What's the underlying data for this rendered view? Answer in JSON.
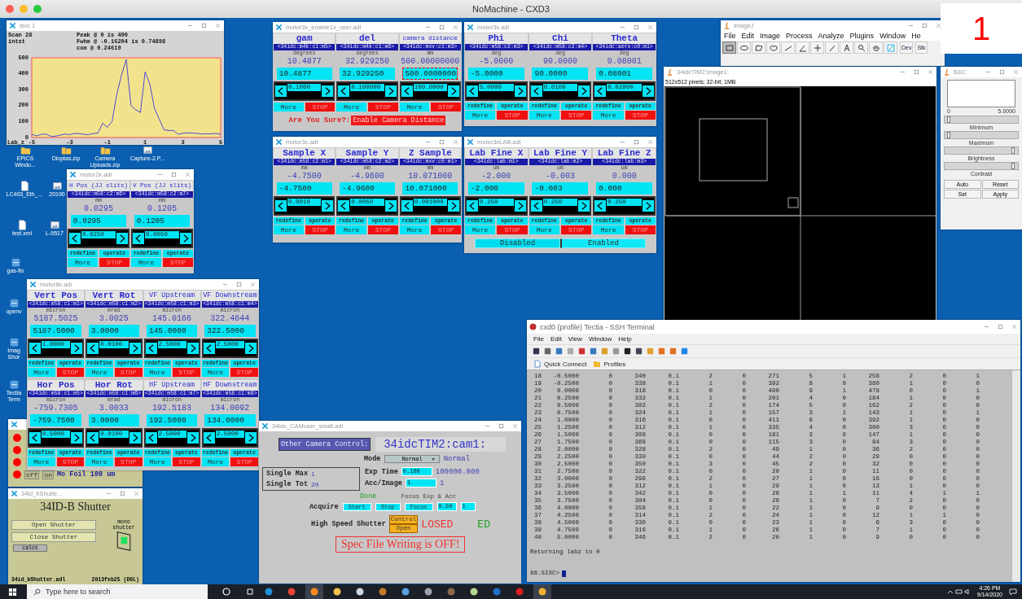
{
  "host_window": {
    "title": "NoMachine - CXD3"
  },
  "corner_label": "1",
  "desktop_icons": [
    {
      "label": "EPICS Windo...",
      "kind": "folder"
    },
    {
      "label": "Dioptas.zip",
      "kind": "zip"
    },
    {
      "label": "Camera Uploads.zip",
      "kind": "zip"
    },
    {
      "label": "Capture-2.P...",
      "kind": "image"
    },
    {
      "label": "LC403_Eth_...",
      "kind": "file"
    },
    {
      "label": "20190",
      "kind": "image"
    },
    {
      "label": "test.xml",
      "kind": "file"
    },
    {
      "label": "L-9517",
      "kind": "image"
    },
    {
      "label": "gas-flo",
      "kind": "app"
    },
    {
      "label": "openv",
      "kind": "app"
    },
    {
      "label": "Imag Shor",
      "kind": "app"
    },
    {
      "label": "Tectia Term",
      "kind": "app"
    }
  ],
  "plot_window": {
    "title": "sixc 1",
    "scan_label": "Scan 28",
    "stats": [
      "Peak @ 0 is 490",
      "Fwhm @ -0.16204 is 0.74898",
      "com @ 0.24619"
    ],
    "chart_data": {
      "type": "line",
      "xlabel": "Lab_z",
      "x": [
        -5,
        -4.75,
        -4.5,
        -4.25,
        -4,
        -3.75,
        -3.5,
        -3.25,
        -3,
        -2.75,
        -2.5,
        -2.25,
        -2,
        -1.75,
        -1.5,
        -1.25,
        -1,
        -0.75,
        -0.5,
        -0.25,
        0,
        0.25,
        0.5,
        0.75,
        1,
        1.25,
        1.5,
        1.75,
        2,
        2.25,
        2.5,
        2.75,
        3,
        3.25,
        3.5,
        3.75,
        4,
        4.25,
        4.5,
        4.75,
        5
      ],
      "series": [
        {
          "name": "intst",
          "color": "#4a4ad8",
          "values": [
            20,
            10,
            20,
            22,
            8,
            8,
            15,
            22,
            18,
            25,
            25,
            20,
            18,
            25,
            28,
            90,
            65,
            100,
            271,
            392,
            490,
            201,
            174,
            157,
            411,
            335,
            181,
            115,
            49,
            44,
            45,
            20,
            27,
            29,
            28,
            26,
            22,
            24,
            23,
            26,
            20
          ]
        }
      ],
      "xlim": [
        -5,
        5
      ],
      "ylim": [
        0,
        500
      ],
      "xticks": [
        -5,
        -3,
        -1,
        1,
        3,
        5
      ],
      "yticks": [
        0,
        100,
        200,
        300,
        400,
        500
      ]
    }
  },
  "motor_windows": [
    {
      "title": "motor3x_enable1x_user.adl",
      "motors": [
        {
          "name": "gam",
          "pv": "<34idc:m4k:c1:m5>",
          "unit": "degrees",
          "readback": "10.4877",
          "setpoint": "10.4877",
          "tweak": "0.1000",
          "focused": false,
          "more": "More",
          "stop": "STOP"
        },
        {
          "name": "del",
          "pv": "<34idc:m4k:c1:m6>",
          "unit": "degrees",
          "readback": "32.929250",
          "setpoint": "32.929250",
          "tweak": "0.100000",
          "focused": false,
          "more": "More",
          "stop": "STOP"
        },
        {
          "name": "camera distance",
          "pv": "<34idc:mxv:c1:m3>",
          "unit": "mm",
          "readback": "500.00000000",
          "setpoint": "500.0000000",
          "tweak": "100.0000",
          "focused": true,
          "more": "More",
          "stop": "STOP"
        }
      ],
      "confirm": {
        "label": "Are You Sure?:",
        "button": "Enable Camera Distance"
      }
    },
    {
      "title": "motor3x.adl",
      "motors": [
        {
          "name": "Phi",
          "pv": "<34idc:m58:c2:m3>",
          "unit": "deg",
          "readback": "-5.0000",
          "setpoint": "-5.0000",
          "tweak": "5.0000",
          "focused": false,
          "redefine": "redefine",
          "operate": "operate",
          "more": "More",
          "stop": "STOP"
        },
        {
          "name": "Chi",
          "pv": "<34idc:m58:c2:m4>",
          "unit": "deg",
          "readback": "90.0000",
          "setpoint": "90.0000",
          "tweak": "0.0100",
          "focused": false,
          "redefine": "redefine",
          "operate": "operate",
          "more": "More",
          "stop": "STOP"
        },
        {
          "name": "Theta",
          "pv": "<34idc:aero:c0:m1>",
          "unit": "deg",
          "readback": "0.08001",
          "setpoint": "0.08001",
          "tweak": "0.02000",
          "focused": false,
          "redefine": "redefine",
          "operate": "operate",
          "more": "More",
          "stop": "STOP"
        }
      ]
    },
    {
      "title": "motor2x.adl",
      "motors": [
        {
          "name": "H Pos (JJ slits)",
          "pv": "<34idc:m58:c2:m6>",
          "unit": "mm",
          "readback": "0.0295",
          "setpoint": "0.0295",
          "tweak": "0.0250",
          "focused": false,
          "redefine": "redefine",
          "operate": "operate",
          "more": "More",
          "stop": "STOP"
        },
        {
          "name": "V Pos (JJ slits)",
          "pv": "<34idc:m58:c2:m7>",
          "unit": "mm",
          "readback": "0.1205",
          "setpoint": "0.1205",
          "tweak": "0.0050",
          "focused": false,
          "redefine": "redefine",
          "operate": "operate",
          "more": "More",
          "stop": "STOP"
        }
      ]
    },
    {
      "title": "motor3x.adl",
      "motors": [
        {
          "name": "Sample X",
          "pv": "<34idc:m58:c2:m1>",
          "unit": "mm",
          "readback": "-4.7500",
          "setpoint": "-4.7500",
          "tweak": "0.0010",
          "focused": false,
          "redefine": "redefine",
          "operate": "operate",
          "more": "More",
          "stop": "STOP"
        },
        {
          "name": "Sample Y",
          "pv": "<34idc:m58:c2:m2>",
          "unit": "mm",
          "readback": "-4.9600",
          "setpoint": "-4.9600",
          "tweak": "0.0050",
          "focused": false,
          "redefine": "redefine",
          "operate": "operate",
          "more": "More",
          "stop": "STOP"
        },
        {
          "name": "Z Sample",
          "pv": "<34idc:mxv:c0:m1>",
          "unit": "mm",
          "readback": "10.071000",
          "setpoint": "10.071000",
          "tweak": "0.001000",
          "focused": false,
          "redefine": "redefine",
          "operate": "operate",
          "more": "More",
          "stop": "STOP"
        }
      ]
    },
    {
      "title": "motor3xLAB.adl",
      "motors": [
        {
          "name": "Lab Fine X",
          "pv": "<34idc:lab:m1>",
          "unit": "um",
          "readback": "-2.000",
          "setpoint": "-2.000",
          "tweak": "0.250",
          "focused": false,
          "redefine": "redefine",
          "operate": "operate",
          "more": "More",
          "stop": "STOP"
        },
        {
          "name": "Lab Fine Y",
          "pv": "<34idc:lab:m2>",
          "unit": "um",
          "readback": "-0.003",
          "setpoint": "-0.003",
          "tweak": "0.250",
          "focused": false,
          "redefine": "redefine",
          "operate": "operate",
          "more": "More",
          "stop": "STOP"
        },
        {
          "name": "Lab Fine Z",
          "pv": "<34idc:lab:m3>",
          "unit": "um",
          "readback": "0.000",
          "setpoint": "0.000",
          "tweak": "0.250",
          "focused": false,
          "redefine": "redefine",
          "operate": "operate",
          "more": "More",
          "stop": "STOP"
        }
      ],
      "toggle": [
        {
          "label": "Disabled",
          "selected": false
        },
        {
          "label": "Enabled",
          "selected": true
        }
      ]
    },
    {
      "title": "motor8x.adl",
      "motors": [
        {
          "name": "Vert Pos",
          "pv": "<34idc:m58:c1:m1>",
          "unit": "micron",
          "readback": "5187.5025",
          "setpoint": "5187.5000",
          "tweak": "1.0000",
          "focused": false,
          "redefine": "redefine",
          "operate": "operate",
          "more": "More",
          "stop": "STOP"
        },
        {
          "name": "Vert Rot",
          "pv": "<34idc:m58:c1:m2>",
          "unit": "mrad",
          "readback": "3.0025",
          "setpoint": "3.0000",
          "tweak": "0.0100",
          "focused": false,
          "redefine": "redefine",
          "operate": "operate",
          "more": "More",
          "stop": "STOP"
        },
        {
          "name": "VF Upstream",
          "pv": "<34idc:m58:c1:m3>",
          "unit": "micron",
          "readback": "145.0166",
          "setpoint": "145.0000",
          "tweak": "2.5000",
          "focused": false,
          "redefine": "redefine",
          "operate": "operate",
          "more": "More",
          "stop": "STOP"
        },
        {
          "name": "VF Downstream",
          "pv": "<34idc:m58:c1:m4>",
          "unit": "micron",
          "readback": "322.4644",
          "setpoint": "322.5000",
          "tweak": "2.5000",
          "focused": false,
          "redefine": "redefine",
          "operate": "operate",
          "more": "More",
          "stop": "STOP"
        },
        {
          "name": "Hor Pos",
          "pv": "<34idc:m58:c1:m5>",
          "unit": "micron",
          "readback": "-759.7305",
          "setpoint": "-759.7500",
          "tweak": "0.5000",
          "focused": false,
          "redefine": "redefine",
          "operate": "operate",
          "more": "More",
          "stop": "STOP"
        },
        {
          "name": "Hor Rot",
          "pv": "<34idc:m58:c1:m6>",
          "unit": "mrad",
          "readback": "3.0033",
          "setpoint": "3.0000",
          "tweak": "0.0100",
          "focused": false,
          "redefine": "redefine",
          "operate": "operate",
          "more": "More",
          "stop": "STOP"
        },
        {
          "name": "HF Upstream",
          "pv": "<34idc:m58:c1:m7>",
          "unit": "micron",
          "readback": "192.5183",
          "setpoint": "192.5000",
          "tweak": "2.5000",
          "focused": false,
          "redefine": "redefine",
          "operate": "operate",
          "more": "More",
          "stop": "STOP"
        },
        {
          "name": "HF Downstream",
          "pv": "<34idc:m58:c1:m8>",
          "unit": "micron",
          "readback": "134.0092",
          "setpoint": "134.0000",
          "tweak": "2.5000",
          "focused": false,
          "redefine": "redefine",
          "operate": "operate",
          "more": "More",
          "stop": "STOP"
        }
      ]
    }
  ],
  "filter_window": {
    "indicators": [
      {
        "color": "#ff0000"
      },
      {
        "color": "#ff0000"
      },
      {
        "color": "#ff0000"
      },
      {
        "color": "#ff0000"
      }
    ],
    "off_label": "off",
    "on_label": "on",
    "filter_name": "Mo Foil 100 um"
  },
  "shutter_window": {
    "title": "34id_bShutte...",
    "heading": "34ID-B Shutter",
    "indicator_label": "mono shutter",
    "open": true,
    "open_button": "Open Shutter",
    "close_button": "Close Shutter",
    "calcs_button": "calcs",
    "file_label": "34id_bShutter.adl",
    "date_label": "2013feb25 (DGL)"
  },
  "camera_window": {
    "title": "34idc_CAMuser_small.adl",
    "other_button": "Other Camera Control:",
    "camera_name": "34idcTIM2:cam1:",
    "mode_label": "Mode",
    "mode_value": "Normal",
    "mode_readback": "Normal",
    "single_max_label": "Single Max",
    "single_max": "1",
    "single_tot_label": "Single Tot",
    "single_tot": "20",
    "exp_label": "Exp Time",
    "exp_value": "0.100",
    "exp_readback": "100000.000",
    "acc_label": "Acc/Image",
    "acc_value": "1",
    "acc_readback": "1",
    "status": "Done",
    "focus_label": "Focus Exp & Acc",
    "acquire_label": "Acquire",
    "acquire_buttons": [
      "Start",
      "Stop",
      "Focus"
    ],
    "focus_exp": "0.50",
    "focus_acc": "1",
    "shutter_label": "High Speed Shutter",
    "shutter_buttons": [
      "Control",
      "Open"
    ],
    "shutter_state": "LOSED",
    "shutter_state_2": "ED",
    "spec_warning": "Spec File Writing is OFF!"
  },
  "imagej_window": {
    "title": "ImageJ",
    "menus": [
      "File",
      "Edit",
      "Image",
      "Process",
      "Analyze",
      "Plugins",
      "Window",
      "He"
    ],
    "tools": [
      {
        "kind": "rectangle",
        "selected": true
      },
      {
        "kind": "oval",
        "selected": false
      },
      {
        "kind": "polygon",
        "selected": false
      },
      {
        "kind": "freehand",
        "selected": false
      },
      {
        "kind": "line",
        "selected": false
      },
      {
        "kind": "angle",
        "selected": false
      },
      {
        "kind": "point",
        "selected": false
      },
      {
        "kind": "wand",
        "selected": false
      },
      {
        "kind": "text",
        "selected": false
      },
      {
        "kind": "zoom",
        "selected": false
      },
      {
        "kind": "hand",
        "selected": false
      },
      {
        "kind": "color",
        "selected": false
      }
    ],
    "dropdowns": [
      "Dev",
      "Stk"
    ]
  },
  "image_window": {
    "title": "34idcTIM2:image1:",
    "info": "512x512 pixels; 32-bit; 1MB"
  },
  "bc_window": {
    "title": "B&C",
    "range_min": "0",
    "range_max": "5.0000",
    "sliders": [
      {
        "label": "Minimum",
        "level": 0.03
      },
      {
        "label": "Maximum",
        "level": 0.03
      },
      {
        "label": "Brightness",
        "level": 0.95
      },
      {
        "label": "Contrast",
        "level": 0.95
      }
    ],
    "buttons": [
      "Auto",
      "Reset",
      "Set",
      "Apply"
    ]
  },
  "terminal_window": {
    "title": "cxd0 (profile) Tectia - SSH Terminal",
    "menus": [
      "File",
      "Edit",
      "View",
      "Window",
      "Help"
    ],
    "quick_connect": "Quick Connect",
    "profiles": "Profiles",
    "rows": [
      [
        "18",
        "-0.5000",
        "0",
        "340",
        "0.1",
        "2",
        "0",
        "271",
        "5",
        "1",
        "256",
        "2",
        "0",
        "1"
      ],
      [
        "19",
        "-0.2500",
        "0",
        "338",
        "0.1",
        "1",
        "0",
        "392",
        "8",
        "0",
        "380",
        "1",
        "0",
        "0"
      ],
      [
        "20",
        "0.0000",
        "0",
        "318",
        "0.1",
        "0",
        "0",
        "490",
        "9",
        "1",
        "478",
        "0",
        "0",
        "1"
      ],
      [
        "21",
        "0.2500",
        "0",
        "332",
        "0.1",
        "1",
        "0",
        "201",
        "4",
        "0",
        "184",
        "1",
        "0",
        "0"
      ],
      [
        "22",
        "0.5000",
        "0",
        "302",
        "0.1",
        "2",
        "0",
        "174",
        "5",
        "0",
        "162",
        "2",
        "0",
        "0"
      ],
      [
        "23",
        "0.7500",
        "0",
        "324",
        "0.1",
        "1",
        "0",
        "157",
        "3",
        "1",
        "143",
        "1",
        "0",
        "1"
      ],
      [
        "24",
        "1.0000",
        "0",
        "316",
        "0.1",
        "0",
        "0",
        "411",
        "6",
        "0",
        "392",
        "1",
        "0",
        "0"
      ],
      [
        "25",
        "1.2500",
        "0",
        "312",
        "0.1",
        "1",
        "0",
        "335",
        "4",
        "0",
        "300",
        "3",
        "0",
        "0"
      ],
      [
        "26",
        "1.5000",
        "0",
        "308",
        "0.1",
        "0",
        "0",
        "181",
        "3",
        "0",
        "147",
        "1",
        "0",
        "0"
      ],
      [
        "27",
        "1.7500",
        "0",
        "368",
        "0.1",
        "0",
        "0",
        "115",
        "3",
        "0",
        "84",
        "3",
        "0",
        "0"
      ],
      [
        "28",
        "2.0000",
        "0",
        "328",
        "0.1",
        "2",
        "0",
        "49",
        "1",
        "0",
        "36",
        "2",
        "0",
        "0"
      ],
      [
        "29",
        "2.2500",
        "0",
        "330",
        "0.1",
        "0",
        "0",
        "44",
        "2",
        "0",
        "29",
        "0",
        "0",
        "0"
      ],
      [
        "30",
        "2.5000",
        "0",
        "350",
        "0.1",
        "3",
        "0",
        "45",
        "2",
        "0",
        "32",
        "0",
        "0",
        "0"
      ],
      [
        "31",
        "2.7500",
        "0",
        "322",
        "0.1",
        "0",
        "0",
        "20",
        "1",
        "0",
        "11",
        "0",
        "0",
        "0"
      ],
      [
        "32",
        "3.0000",
        "0",
        "298",
        "0.1",
        "2",
        "0",
        "27",
        "1",
        "0",
        "16",
        "0",
        "0",
        "0"
      ],
      [
        "33",
        "3.2500",
        "0",
        "312",
        "0.1",
        "1",
        "0",
        "29",
        "1",
        "0",
        "13",
        "1",
        "0",
        "0"
      ],
      [
        "34",
        "3.5000",
        "0",
        "342",
        "0.1",
        "0",
        "0",
        "28",
        "1",
        "1",
        "11",
        "4",
        "1",
        "1"
      ],
      [
        "35",
        "3.7500",
        "0",
        "304",
        "0.1",
        "0",
        "0",
        "26",
        "1",
        "0",
        "7",
        "2",
        "0",
        "0"
      ],
      [
        "36",
        "4.0000",
        "0",
        "358",
        "0.1",
        "1",
        "0",
        "22",
        "1",
        "0",
        "9",
        "0",
        "0",
        "0"
      ],
      [
        "37",
        "4.2500",
        "0",
        "314",
        "0.1",
        "2",
        "0",
        "24",
        "1",
        "0",
        "12",
        "1",
        "1",
        "0"
      ],
      [
        "38",
        "4.5000",
        "0",
        "330",
        "0.1",
        "0",
        "0",
        "23",
        "1",
        "0",
        "6",
        "3",
        "0",
        "0"
      ],
      [
        "39",
        "4.7500",
        "0",
        "316",
        "0.1",
        "1",
        "0",
        "26",
        "1",
        "0",
        "7",
        "1",
        "0",
        "0"
      ],
      [
        "40",
        "5.0000",
        "0",
        "346",
        "0.1",
        "2",
        "0",
        "20",
        "1",
        "0",
        "9",
        "0",
        "0",
        "0"
      ]
    ],
    "message": "Returning labz to 0",
    "prompt": "86.SIXC>"
  },
  "taskbar": {
    "search_placeholder": "Type here to search",
    "time": "4:26 PM",
    "date": "9/14/2020"
  }
}
